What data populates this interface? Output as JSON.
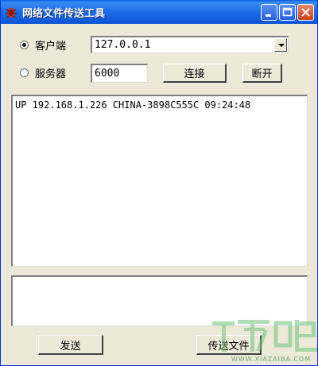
{
  "window": {
    "title": "网络文件传送工具",
    "accent": "#0c55d6"
  },
  "mode": {
    "client_label": "客户端",
    "server_label": "服务器",
    "selected": "client"
  },
  "address": {
    "value": "127.0.0.1"
  },
  "port": {
    "value": "6000"
  },
  "buttons": {
    "connect": "连接",
    "disconnect": "断开",
    "send": "发送",
    "send_file": "传送文件"
  },
  "log": {
    "lines": [
      "UP 192.168.1.226 CHINA-3898C555C 09:24:48"
    ]
  },
  "message": {
    "value": ""
  },
  "watermark": {
    "site": "WWW.XIAZAIBA.COM"
  }
}
